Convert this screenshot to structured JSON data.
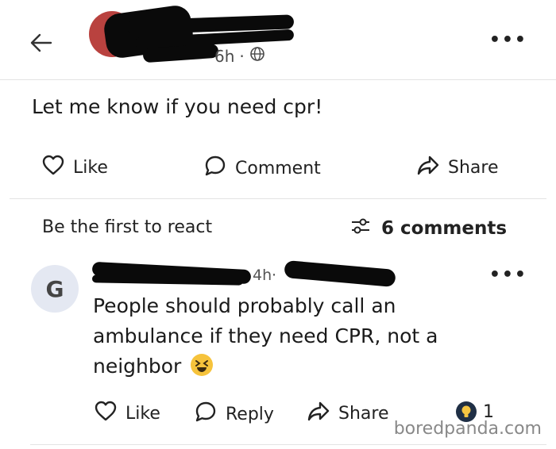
{
  "post": {
    "meta_time": "6h",
    "text": "Let me know if you need cpr!",
    "actions": {
      "like": "Like",
      "comment": "Comment",
      "share": "Share"
    },
    "react_text": "Be the first to react",
    "comments_count": "6 comments"
  },
  "comment": {
    "avatar_letter": "G",
    "meta_time": "4h",
    "text": "People should probably call an ambulance if they need CPR, not a neighbor",
    "actions": {
      "like": "Like",
      "reply": "Reply",
      "share": "Share"
    },
    "reaction_count": "1"
  },
  "watermark": "boredpanda.com"
}
